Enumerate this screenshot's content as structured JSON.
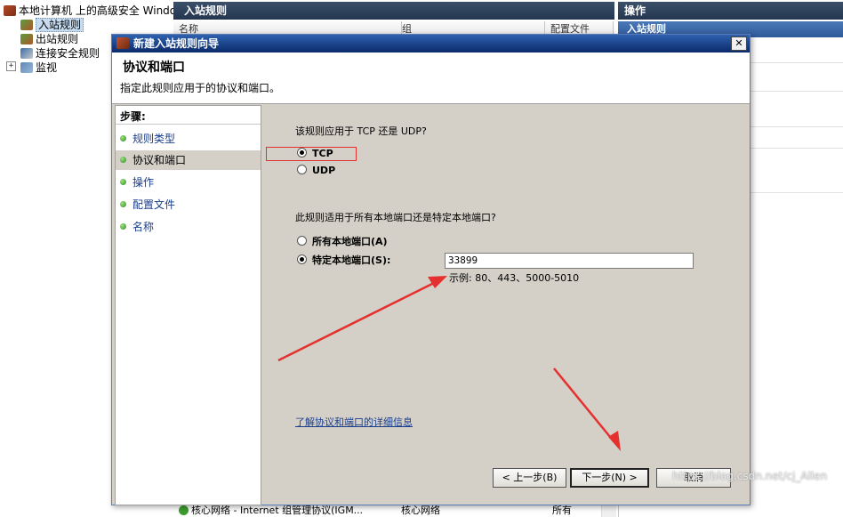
{
  "tree": {
    "root": "本地计算机 上的高级安全 Windows 防火墙",
    "items": [
      "入站规则",
      "出站规则",
      "连接安全规则",
      "监视"
    ]
  },
  "center": {
    "title": "入站规则",
    "columns": [
      "名称",
      "组",
      "配置文件"
    ],
    "bottom_row": {
      "name": "核心网络 - Internet 组管理协议(IGM...",
      "group": "核心网络",
      "profile": "所有"
    }
  },
  "actions": {
    "title": "操作",
    "section": "入站规则"
  },
  "dialog": {
    "title": "新建入站规则向导",
    "close_glyph": "✕",
    "page_title": "协议和端口",
    "page_subtitle": "指定此规则应用于的协议和端口。",
    "steps_title": "步骤:",
    "steps": [
      "规则类型",
      "协议和端口",
      "操作",
      "配置文件",
      "名称"
    ],
    "question_protocol": "该规则应用于 TCP 还是 UDP?",
    "protocol_tcp": "TCP",
    "protocol_udp": "UDP",
    "question_port": "此规则适用于所有本地端口还是特定本地端口?",
    "port_all": "所有本地端口(A)",
    "port_specific": "特定本地端口(S):",
    "port_value": "33899",
    "port_example": "示例: 80、443、5000-5010",
    "learn_more": "了解协议和端口的详细信息",
    "back_button": "< 上一步(B)",
    "next_button": "下一步(N) >",
    "cancel_button": "取消"
  },
  "watermark": "https://blog.csdn.net/cj_Allen",
  "colors": {
    "highlight_box": "#e53030",
    "arrow": "#e53030",
    "step_dot": "#2d8a1e"
  }
}
